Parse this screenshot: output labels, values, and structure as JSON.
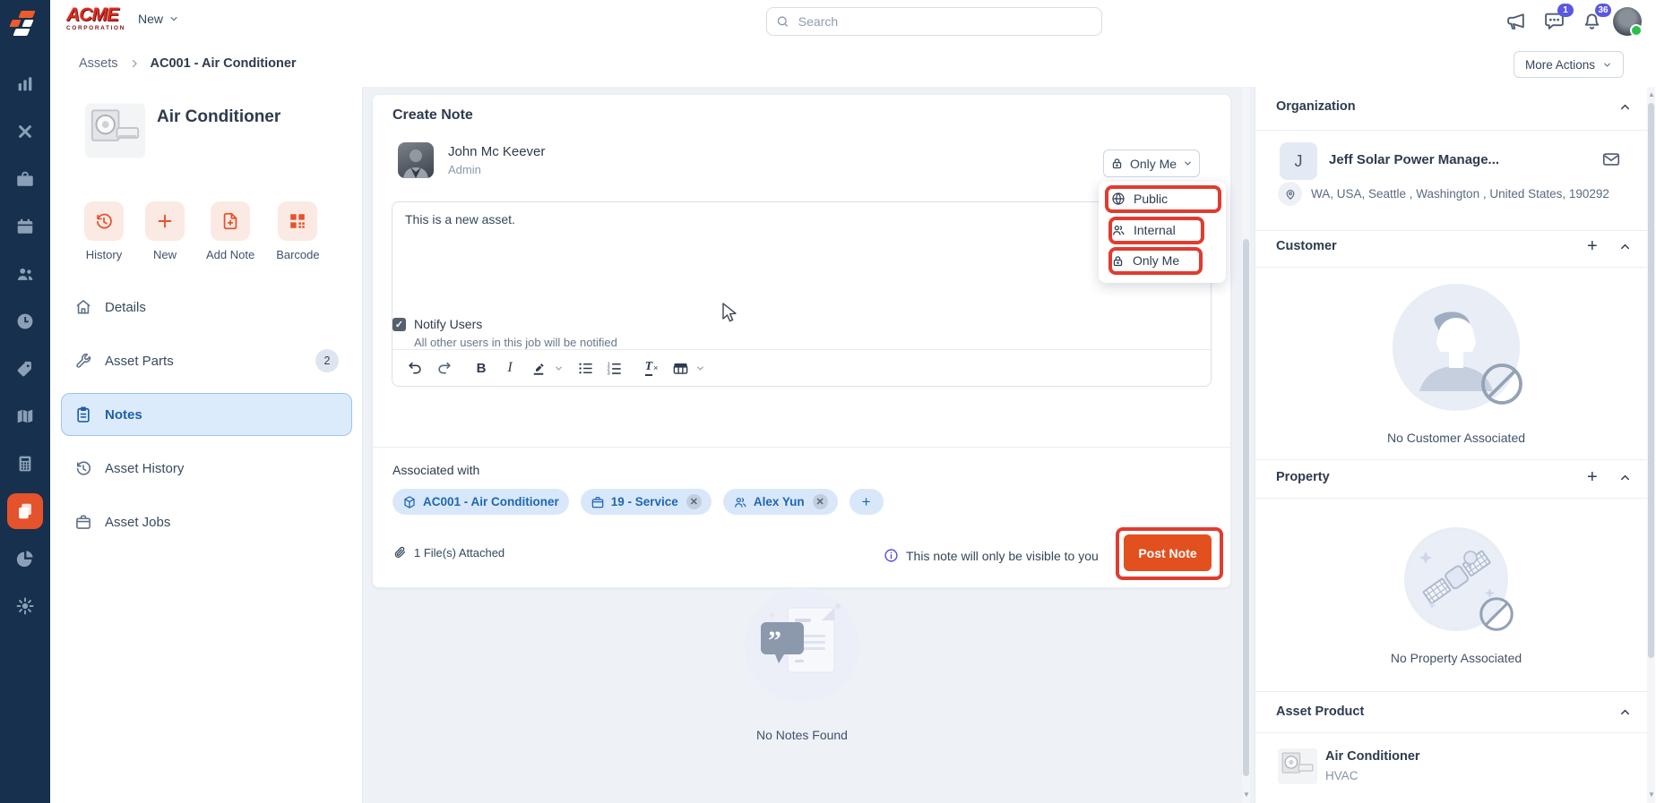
{
  "topbar": {
    "brand_line1": "ACME",
    "brand_line2": "CORPORATION",
    "new_label": "New",
    "search_placeholder": "Search",
    "chat_badge": "1",
    "bell_badge": "36"
  },
  "breadcrumb": {
    "root": "Assets",
    "current": "AC001 - Air Conditioner",
    "more_actions_label": "More Actions"
  },
  "asset_panel": {
    "title": "Air Conditioner",
    "actions": [
      {
        "label": "History"
      },
      {
        "label": "New"
      },
      {
        "label": "Add Note"
      },
      {
        "label": "Barcode"
      }
    ],
    "menu": [
      {
        "label": "Details"
      },
      {
        "label": "Asset Parts",
        "badge": "2"
      },
      {
        "label": "Notes"
      },
      {
        "label": "Asset History"
      },
      {
        "label": "Asset Jobs"
      }
    ]
  },
  "create_note": {
    "title": "Create Note",
    "author_name": "John Mc Keever",
    "author_role": "Admin",
    "visibility_selected": "Only Me",
    "visibility_options": [
      {
        "label": "Public",
        "icon": "globe-icon"
      },
      {
        "label": "Internal",
        "icon": "users-icon"
      },
      {
        "label": "Only Me",
        "icon": "lock-icon"
      }
    ],
    "note_text": "This is a new asset.",
    "notify_label": "Notify Users",
    "notify_hint": "All other users in this job will be notified",
    "notify_checked": "✓",
    "associated_label": "Associated with",
    "associations": [
      {
        "label": "AC001 - Air Conditioner",
        "icon": "cube-icon",
        "removable": false
      },
      {
        "label": "19 - Service",
        "icon": "briefcase-icon",
        "removable": true
      },
      {
        "label": "Alex Yun",
        "icon": "users-icon",
        "removable": true
      }
    ],
    "remove_glyph": "✕",
    "files_attached": "1 File(s) Attached",
    "visibility_note": "This note will only be visible to you",
    "post_label": "Post Note"
  },
  "notes_list": {
    "empty_text": "No Notes Found"
  },
  "right_panel": {
    "organization": {
      "title": "Organization",
      "avatar_letter": "J",
      "name": "Jeff Solar Power Manage...",
      "address": "WA, USA, Seattle , Washington , United States, 190292"
    },
    "customer": {
      "title": "Customer",
      "empty_text": "No Customer Associated"
    },
    "property": {
      "title": "Property",
      "empty_text": "No Property Associated"
    },
    "asset_product": {
      "title": "Asset Product",
      "name": "Air Conditioner",
      "category": "HVAC"
    }
  },
  "colors": {
    "accent_orange": "#e4532c",
    "annotation_red": "#e13b30",
    "accent_blue": "#1f66b0",
    "sidebar_navy": "#16304d",
    "badge_indigo": "#5b57e0",
    "active_menu_bg": "#dcebfb"
  }
}
